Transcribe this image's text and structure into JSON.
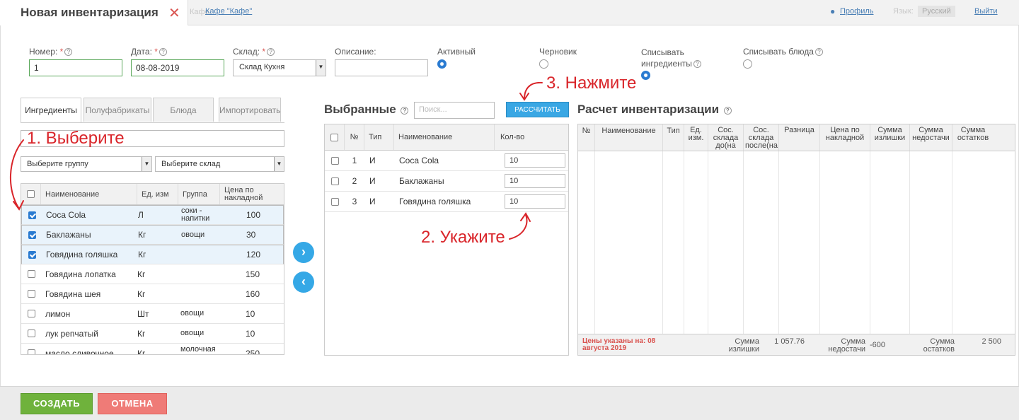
{
  "header": {
    "title": "Новая инвентаризация",
    "place_label": "Кафе:",
    "place_link": "Кафе \"Кафе\"",
    "profile": "Профиль",
    "lang_label": "Язык:",
    "lang_value": "Русский",
    "logout": "Выйти"
  },
  "form": {
    "number_label": "Номер:",
    "number_value": "1",
    "date_label": "Дата:",
    "date_value": "08-08-2019",
    "warehouse_label": "Склад:",
    "warehouse_value": "Склад Кухня",
    "description_label": "Описание:",
    "description_value": "",
    "radios": [
      {
        "label": "Активный",
        "checked": true
      },
      {
        "label": "Черновик",
        "checked": false
      },
      {
        "label": "Списывать ингредиенты",
        "checked": true
      },
      {
        "label": "Списывать блюда",
        "checked": false
      }
    ]
  },
  "tabs": [
    "Ингредиенты",
    "Полуфабрикаты",
    "Блюда",
    "Импортировать"
  ],
  "left": {
    "search_value": "",
    "group_select": "Выберите группу",
    "warehouse_select": "Выберите склад",
    "columns": [
      "Наименование",
      "Ед. изм",
      "Группа",
      "Цена по накладной"
    ],
    "rows": [
      {
        "name": "Coca Cola",
        "unit": "Л",
        "group": "соки - напитки",
        "price": "100",
        "checked": true
      },
      {
        "name": "Баклажаны",
        "unit": "Кг",
        "group": "овощи",
        "price": "30",
        "checked": true
      },
      {
        "name": "Говядина голяшка",
        "unit": "Кг",
        "group": "",
        "price": "120",
        "checked": true
      },
      {
        "name": "Говядина лопатка",
        "unit": "Кг",
        "group": "",
        "price": "150",
        "checked": false
      },
      {
        "name": "Говядина шея",
        "unit": "Кг",
        "group": "",
        "price": "160",
        "checked": false
      },
      {
        "name": "лимон",
        "unit": "Шт",
        "group": "овощи",
        "price": "10",
        "checked": false
      },
      {
        "name": "лук репчатый",
        "unit": "Кг",
        "group": "овощи",
        "price": "10",
        "checked": false
      },
      {
        "name": "масло сливочное",
        "unit": "Кг",
        "group": "молочная продукция",
        "price": "250",
        "checked": false
      }
    ]
  },
  "middle": {
    "title": "Выбранные",
    "search_placeholder": "Поиск...",
    "calc_button": "РАССЧИТАТЬ",
    "columns": [
      "№",
      "Тип",
      "Наименование",
      "Кол-во"
    ],
    "rows": [
      {
        "n": "1",
        "type": "И",
        "name": "Coca Cola",
        "qty": "10"
      },
      {
        "n": "2",
        "type": "И",
        "name": "Баклажаны",
        "qty": "10"
      },
      {
        "n": "3",
        "type": "И",
        "name": "Говядина голяшка",
        "qty": "10"
      }
    ]
  },
  "right": {
    "title": "Расчет инвентаризации",
    "columns": [
      "№",
      "Наименование",
      "Тип",
      "Ед. изм.",
      "Сос. склада до(на",
      "Сос. склада после(на",
      "Разница",
      "Цена по накладной",
      "Сумма излишки",
      "Сумма недостачи",
      "Сумма остатков"
    ],
    "footer_note": "Цены указаны на: 08 августа 2019",
    "surplus_label": "Сумма излишки",
    "surplus_value": "1 057.76",
    "shortage_label": "Сумма недостачи",
    "shortage_value": "-600",
    "balance_label": "Сумма остатков",
    "balance_value": "2 500"
  },
  "annotations": {
    "step1": "1. Выберите",
    "step2": "2. Укажите",
    "step3": "3. Нажмите"
  },
  "footer": {
    "create": "СОЗДАТЬ",
    "cancel": "ОТМЕНА"
  }
}
